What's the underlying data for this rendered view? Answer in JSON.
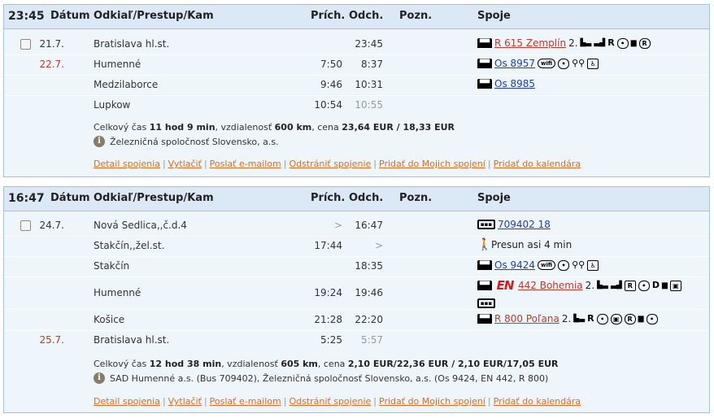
{
  "columns": {
    "date": "Dátum",
    "route": "Odkiaľ/Prestup/Kam",
    "arrival": "Prích.",
    "departure": "Odch.",
    "note": "Pozn.",
    "services": "Spoje"
  },
  "connections": [
    {
      "time": "23:45",
      "rows": [
        {
          "date": "21.7.",
          "station": "Bratislava hl.st.",
          "arr": "",
          "dep": "23:45",
          "link": "R 615 Zemplín",
          "extra": "2."
        },
        {
          "date": "22.7.",
          "station": "Humenné",
          "arr": "7:50",
          "dep": "8:37",
          "link": "Os 8957"
        },
        {
          "date": "",
          "station": "Medzilaborce",
          "arr": "9:46",
          "dep": "10:31",
          "link": "Os 8985"
        },
        {
          "date": "",
          "station": "Lupkow",
          "arr": "10:54",
          "dep": "10:55"
        }
      ],
      "summary": {
        "prefix": "Celkový čas ",
        "duration": "11 hod 9 min",
        "mid1": ", vzdialenosť ",
        "distance": "600 km",
        "mid2": ", cena ",
        "price": "23,64 EUR / 18,33 EUR"
      },
      "carrier": "Železničná spoločnosť Slovensko, a.s.",
      "actions": [
        "Detail spojenia",
        "Vytlačiť",
        "Poslať e-mailom",
        "Odstrániť spojenie",
        "Pridať do Mojich spojení",
        "Pridať do kalendára"
      ]
    },
    {
      "time": "16:47",
      "rows": [
        {
          "date": "24.7.",
          "station": "Nová Sedlica,,č.d.4",
          "arr": ">",
          "dep": "16:47",
          "link": "709402 18"
        },
        {
          "date": "",
          "station": "Stakčín,,žel.st.",
          "arr": "17:44",
          "dep": ">",
          "walk": "Presun asi 4 min"
        },
        {
          "date": "",
          "station": "Stakčín",
          "arr": "",
          "dep": "18:35",
          "link": "Os 9424"
        },
        {
          "date": "",
          "station": "Humenné",
          "arr": "19:24",
          "dep": "19:46",
          "en": "EN",
          "link": "442 Bohemia",
          "extra": "2."
        },
        {
          "date": "",
          "station": "Košice",
          "arr": "21:28",
          "dep": "22:20",
          "link": "R 800 Poľana",
          "extra": "2."
        },
        {
          "date": "25.7.",
          "station": "Bratislava hl.st.",
          "arr": "5:25",
          "dep": "5:57"
        }
      ],
      "summary": {
        "prefix": "Celkový čas ",
        "duration": "12 hod 38 min",
        "mid1": ", vzdialenosť ",
        "distance": "605 km",
        "mid2": ", cena ",
        "price": "2,10 EUR/22,36 EUR / 2,10 EUR/17,05 EUR"
      },
      "carrier": "SAD Humenné a.s. (Bus 709402), Železničná spoločnosť Slovensko, a.s. (Os 9424, EN 442, R 800)",
      "actions": [
        "Detail spojenia",
        "Vytlačiť",
        "Poslať e-mailom",
        "Odstrániť spojenie",
        "Pridať do Mojich spojení",
        "Pridať do kalendára"
      ]
    }
  ],
  "service_letters": {
    "R": "R",
    "D": "D"
  },
  "colors": {
    "accent_link": "#c0392b",
    "blue_link": "#1a3fb7",
    "action_link": "#e36b1b",
    "header_bg": "#dbe8f5",
    "panel_bg": "#eef5fb",
    "border": "#9fc4e3"
  }
}
